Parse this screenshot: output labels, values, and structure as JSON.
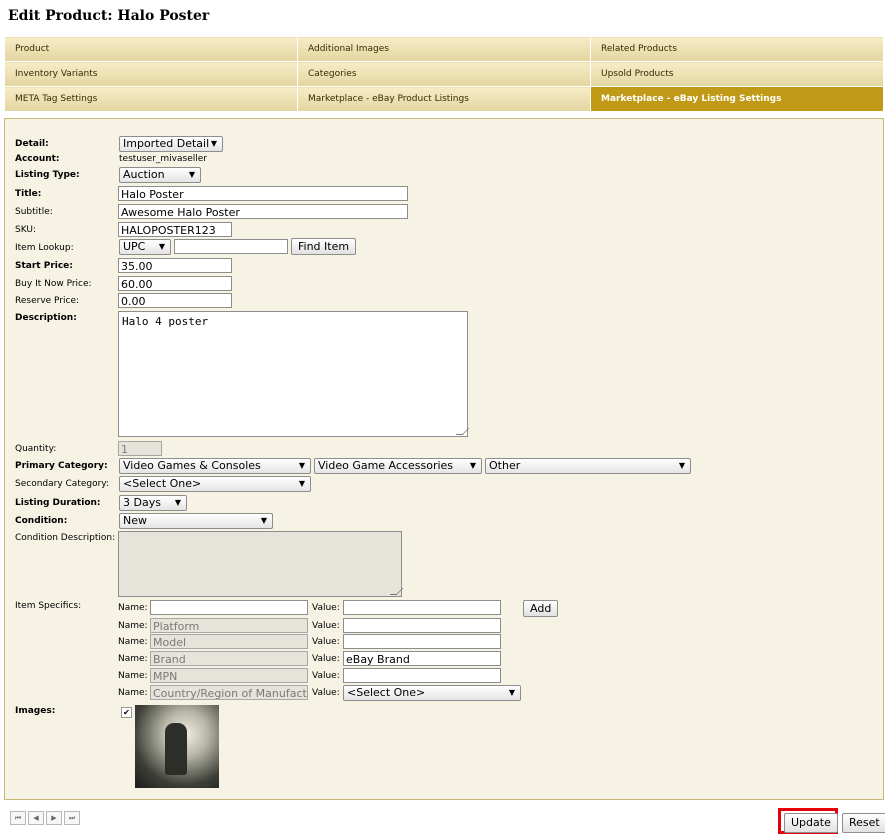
{
  "page_title": "Edit Product: Halo Poster",
  "tabs": [
    {
      "label": "Product",
      "active": false
    },
    {
      "label": "Additional Images",
      "active": false
    },
    {
      "label": "Related Products",
      "active": false
    },
    {
      "label": "Inventory Variants",
      "active": false
    },
    {
      "label": "Categories",
      "active": false
    },
    {
      "label": "Upsold Products",
      "active": false
    },
    {
      "label": "META Tag Settings",
      "active": false
    },
    {
      "label": "Marketplace - eBay Product Listings",
      "active": false
    },
    {
      "label": "Marketplace - eBay Listing Settings",
      "active": true
    }
  ],
  "form": {
    "detail": {
      "label": "Detail:",
      "value": "Imported Detail"
    },
    "account": {
      "label": "Account:",
      "value": "testuser_mivaseller"
    },
    "listing_type": {
      "label": "Listing Type:",
      "value": "Auction"
    },
    "title": {
      "label": "Title:",
      "value": "Halo Poster"
    },
    "subtitle": {
      "label": "Subtitle:",
      "value": "Awesome Halo Poster"
    },
    "sku": {
      "label": "SKU:",
      "value": "HALOPOSTER123"
    },
    "item_lookup": {
      "label": "Item Lookup:",
      "type_value": "UPC",
      "value": "",
      "button": "Find Item"
    },
    "start_price": {
      "label": "Start Price:",
      "value": "35.00"
    },
    "buy_it_now_price": {
      "label": "Buy It Now Price:",
      "value": "60.00"
    },
    "reserve_price": {
      "label": "Reserve Price:",
      "value": "0.00"
    },
    "description": {
      "label": "Description:",
      "value": "Halo 4 poster"
    },
    "quantity": {
      "label": "Quantity:",
      "value": "1"
    },
    "primary_category": {
      "label": "Primary Category:",
      "level1": "Video Games & Consoles",
      "level2": "Video Game Accessories",
      "level3": "Other"
    },
    "secondary_category": {
      "label": "Secondary Category:",
      "value": "<Select One>"
    },
    "listing_duration": {
      "label": "Listing Duration:",
      "value": "3 Days"
    },
    "condition": {
      "label": "Condition:",
      "value": "New"
    },
    "condition_description": {
      "label": "Condition Description:",
      "value": ""
    },
    "item_specifics": {
      "label": "Item Specifics:",
      "name_label": "Name:",
      "value_label": "Value:",
      "add_button": "Add",
      "rows": [
        {
          "name": "",
          "value": "",
          "name_disabled": false,
          "value_is_select": false
        },
        {
          "name": "Platform",
          "value": "",
          "name_disabled": true,
          "value_is_select": false
        },
        {
          "name": "Model",
          "value": "",
          "name_disabled": true,
          "value_is_select": false
        },
        {
          "name": "Brand",
          "value": "eBay Brand",
          "name_disabled": true,
          "value_is_select": false
        },
        {
          "name": "MPN",
          "value": "",
          "name_disabled": true,
          "value_is_select": false
        },
        {
          "name": "Country/Region of Manufacture",
          "value": "<Select One>",
          "name_disabled": true,
          "value_is_select": true
        }
      ]
    },
    "images": {
      "label": "Images:",
      "checked": true,
      "checkmark": "✔"
    }
  },
  "footer": {
    "pager": [
      "⏮",
      "◀",
      "▶",
      "⏭"
    ],
    "update_button": "Update",
    "reset_button": "Reset"
  },
  "colors": {
    "active_tab": "#c09a16",
    "tab": "#eee3b8",
    "panel": "#f6f2e4",
    "highlight": "#e3000b"
  }
}
